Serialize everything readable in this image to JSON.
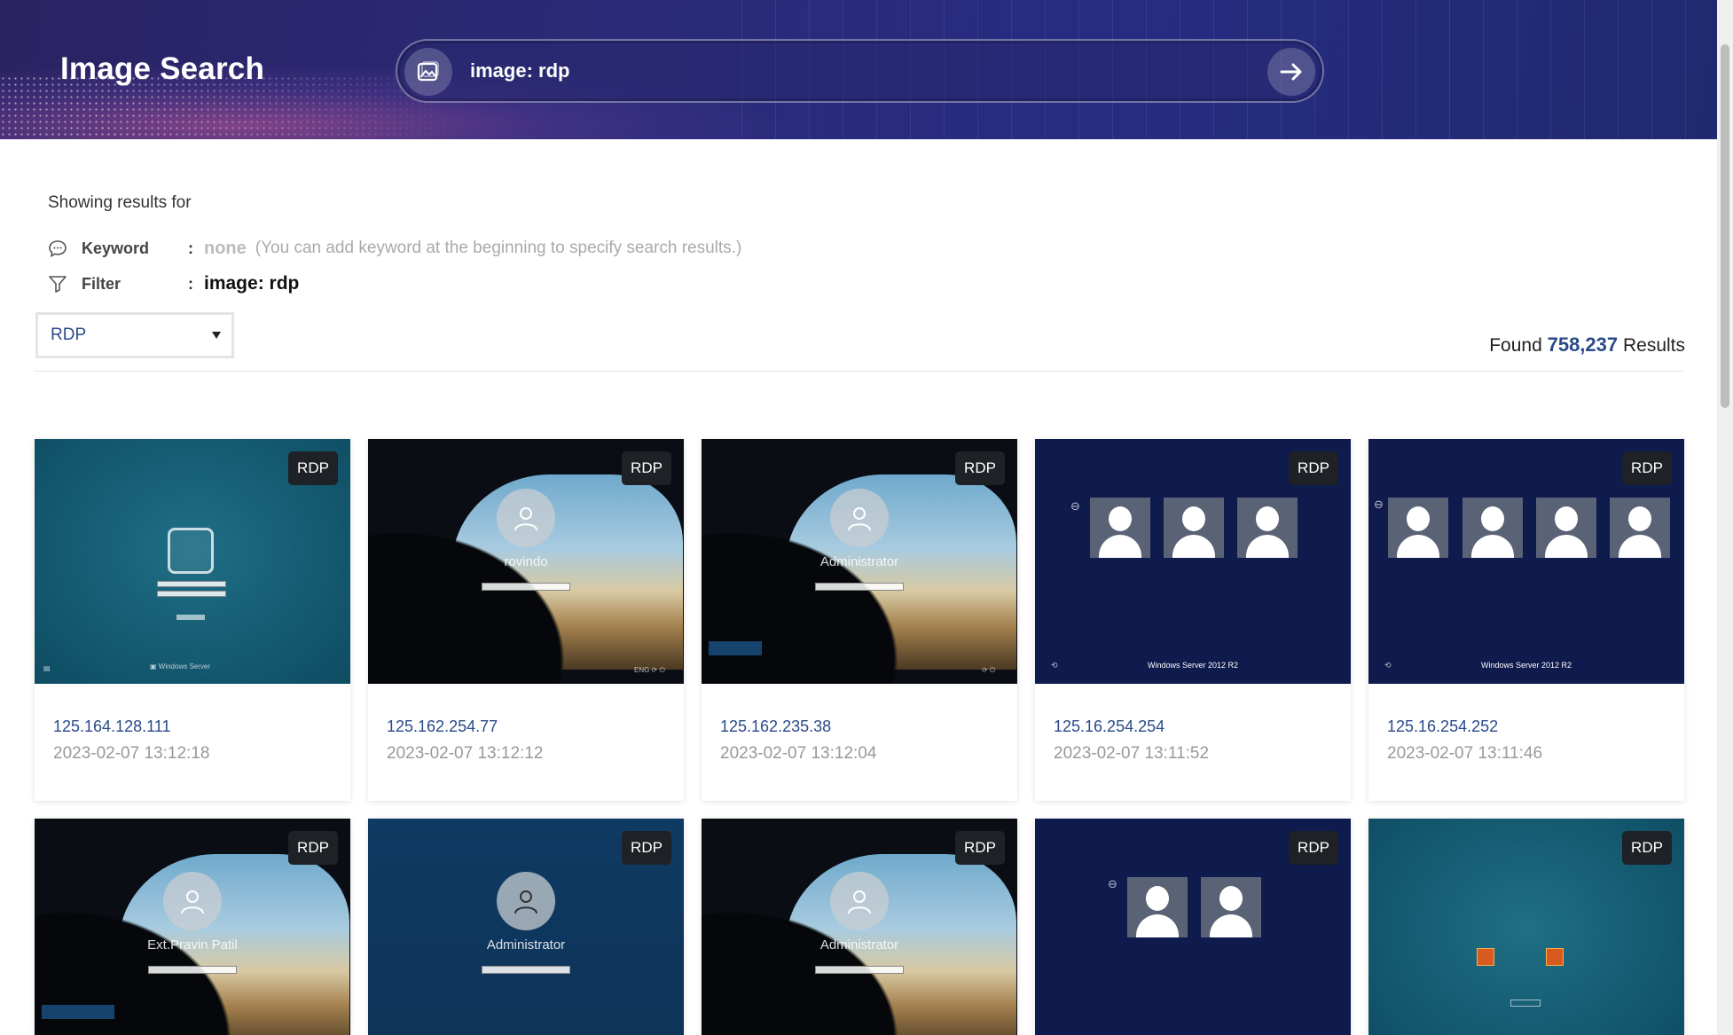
{
  "header": {
    "title": "Image Search",
    "search_value": "image: rdp"
  },
  "info": {
    "showing_label": "Showing results for",
    "keyword_label": "Keyword",
    "keyword_value": "none",
    "keyword_hint": "(You can add keyword at the beginning to specify search results.)",
    "filter_label": "Filter",
    "filter_value": "image: rdp",
    "colon": ":"
  },
  "select": {
    "value": "RDP"
  },
  "results": {
    "prefix": "Found",
    "count": "758,237",
    "suffix": "Results"
  },
  "badge_label": "RDP",
  "cards": [
    {
      "ip": "125.164.128.111",
      "timestamp": "2023-02-07 13:12:18",
      "theme": "teal-login"
    },
    {
      "ip": "125.162.254.77",
      "timestamp": "2023-02-07 13:12:12",
      "theme": "cave",
      "user": "rovindo"
    },
    {
      "ip": "125.162.235.38",
      "timestamp": "2023-02-07 13:12:04",
      "theme": "cave",
      "user": "Administrator"
    },
    {
      "ip": "125.16.254.254",
      "timestamp": "2023-02-07 13:11:52",
      "theme": "navy-tiles",
      "footer": "Windows Server 2012 R2"
    },
    {
      "ip": "125.16.254.252",
      "timestamp": "2023-02-07 13:11:46",
      "theme": "navy-tiles",
      "footer": "Windows Server 2012 R2"
    },
    {
      "theme": "cave",
      "user": "Ext.Pravin Patil"
    },
    {
      "theme": "blue-login",
      "user": "Administrator"
    },
    {
      "theme": "cave",
      "user": "Administrator"
    },
    {
      "theme": "navy-tiles"
    },
    {
      "theme": "teal-icons"
    }
  ]
}
